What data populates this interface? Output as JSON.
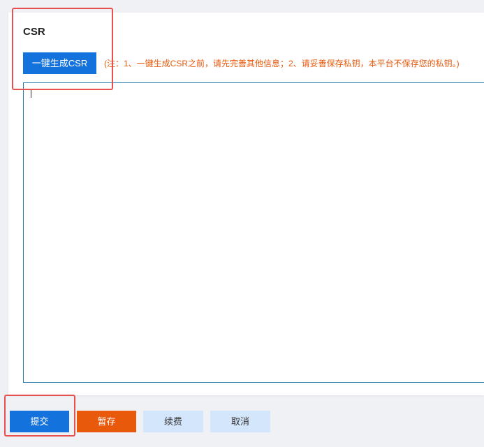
{
  "section": {
    "title": "CSR",
    "generate_button_label": "一键生成CSR",
    "note": "(注：1、一键生成CSR之前，请先完善其他信息；2、请妥善保存私钥，本平台不保存您的私钥。)",
    "csr_value": ""
  },
  "footer": {
    "submit_label": "提交",
    "save_draft_label": "暂存",
    "renew_label": "续费",
    "cancel_label": "取消"
  },
  "colors": {
    "primary": "#1472dc",
    "warning": "#e8590c",
    "light_button": "#d4e6fb",
    "annotation_border": "#e85050",
    "textarea_border": "#2a7fa8"
  }
}
